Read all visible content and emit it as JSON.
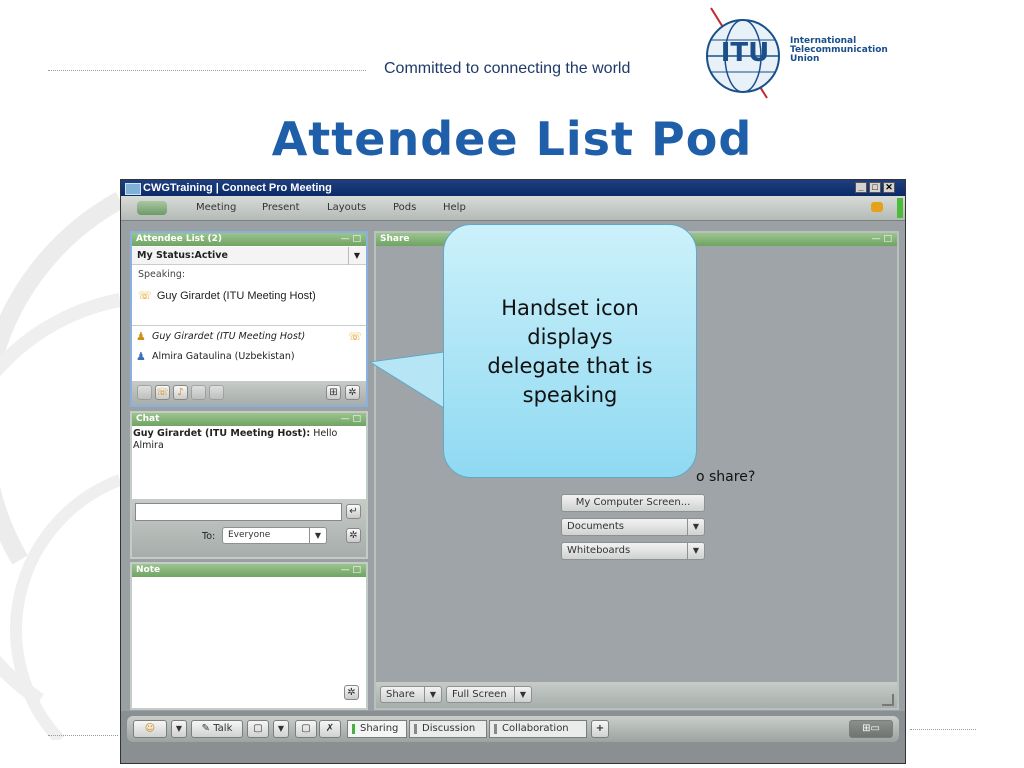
{
  "slide": {
    "tagline": "Committed to connecting the world",
    "org_name": [
      "International",
      "Telecommunication",
      "Union"
    ],
    "logo_text": "ITU",
    "title": "Attendee List Pod"
  },
  "window": {
    "title": "CWGTraining | Connect Pro Meeting",
    "menu": [
      "Meeting",
      "Present",
      "Layouts",
      "Pods",
      "Help"
    ]
  },
  "attendee_pod": {
    "header": "Attendee List (2)",
    "status_label": "My Status:Active",
    "speaking_label": "Speaking:",
    "speaking_person": "Guy Girardet (ITU Meeting Host)",
    "attendees": [
      {
        "name": "Guy Girardet (ITU Meeting Host)",
        "speaking": true
      },
      {
        "name": "Almira Gataulina (Uzbekistan)",
        "speaking": false
      }
    ]
  },
  "chat_pod": {
    "header": "Chat",
    "message_sender": "Guy Girardet (ITU Meeting Host):",
    "message_text": "Hello Almira",
    "to_label": "To:",
    "to_value": "Everyone"
  },
  "note_pod": {
    "header": "Note"
  },
  "share_pod": {
    "header": "Share",
    "question": "o share?",
    "options": [
      "My Computer Screen...",
      "Documents",
      "Whiteboards"
    ],
    "share_button": "Share",
    "fullscreen_button": "Full Screen"
  },
  "bottom_bar": {
    "talk_label": "Talk",
    "tabs": [
      "Sharing",
      "Discussion",
      "Collaboration"
    ],
    "add_label": "+"
  },
  "callout": {
    "lines": [
      "Handset icon",
      "displays",
      "delegate that is",
      "speaking"
    ]
  }
}
